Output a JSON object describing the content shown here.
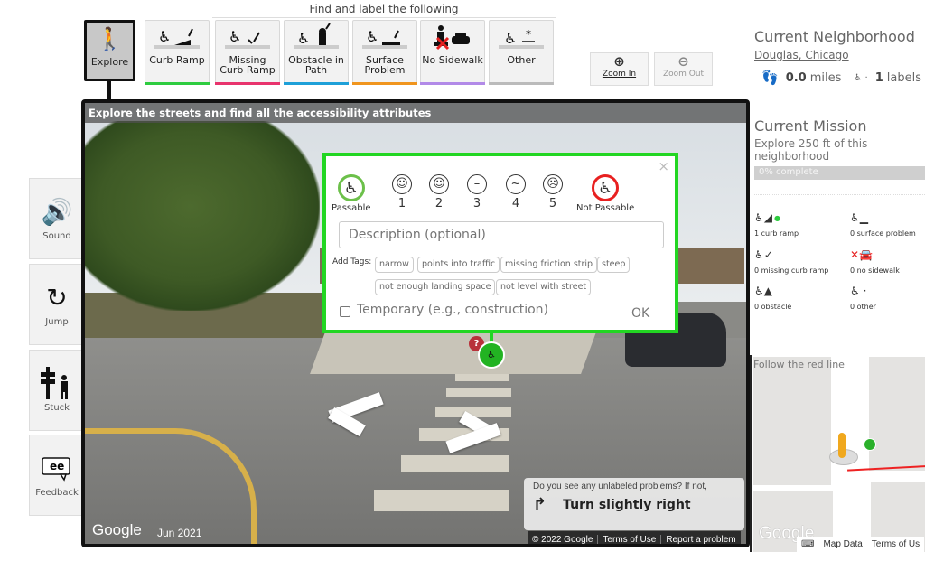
{
  "toolbar": {
    "find_title": "Find and label the following",
    "explore": {
      "label": "Explore",
      "icon": "walking-person-icon"
    },
    "tools": [
      {
        "label": "Curb Ramp",
        "icon": "curb-ramp-icon",
        "color": "#2ecc40"
      },
      {
        "label": "Missing Curb Ramp",
        "icon": "missing-curb-ramp-icon",
        "color": "#e8336d"
      },
      {
        "label": "Obstacle in Path",
        "icon": "obstacle-icon",
        "color": "#1ea0d8"
      },
      {
        "label": "Surface Problem",
        "icon": "surface-problem-icon",
        "color": "#f0951e"
      },
      {
        "label": "No Sidewalk",
        "icon": "no-sidewalk-icon",
        "color": "#b28ae8"
      },
      {
        "label": "Other",
        "icon": "other-icon",
        "color": "#bbbbbb"
      }
    ],
    "zoom_in": "Zoom In",
    "zoom_out": "Zoom Out"
  },
  "side_buttons": [
    {
      "label": "Sound",
      "icon": "speaker-icon"
    },
    {
      "label": "Jump",
      "icon": "jump-icon"
    },
    {
      "label": "Stuck",
      "icon": "stuck-icon"
    },
    {
      "label": "Feedback",
      "icon": "feedback-icon"
    }
  ],
  "streetview": {
    "title": "Explore the streets and find all the accessibility attributes",
    "google": "Google",
    "date": "Jun 2021",
    "footer": [
      "© 2022 Google",
      "Terms of Use",
      "Report a problem"
    ],
    "hint_question": "Do you see any unlabeled problems? If not,",
    "hint_action": "Turn slightly right"
  },
  "popup": {
    "close": "×",
    "passable": "Passable",
    "not_passable": "Not Passable",
    "severity": [
      "1",
      "2",
      "3",
      "4",
      "5"
    ],
    "description_placeholder": "Description (optional)",
    "tags_label": "Add Tags:",
    "tags": [
      "narrow",
      "points into traffic",
      "missing friction strip",
      "steep",
      "not enough landing space",
      "not level with street"
    ],
    "temporary_label": "Temporary (e.g., construction)",
    "ok": "OK",
    "question_marker": "?"
  },
  "neighborhood": {
    "title": "Current Neighborhood",
    "name": "Douglas, Chicago",
    "miles": "0.0",
    "miles_unit": "miles",
    "labels": "1",
    "labels_unit": "labels"
  },
  "mission": {
    "title": "Current Mission",
    "description": "Explore 250 ft of this neighborhood",
    "progress_percent": 0,
    "progress_text": "0% complete",
    "counts": [
      {
        "text": "1 curb ramp",
        "icon": "curb-ramp-icon"
      },
      {
        "text": "0 surface problem",
        "icon": "surface-problem-icon"
      },
      {
        "text": "0 missing curb ramp",
        "icon": "missing-curb-ramp-icon"
      },
      {
        "text": "0 no sidewalk",
        "icon": "no-sidewalk-icon"
      },
      {
        "text": "0 obstacle",
        "icon": "obstacle-icon"
      },
      {
        "text": "0 other",
        "icon": "other-icon"
      }
    ]
  },
  "minimap": {
    "instruction": "Follow the red line",
    "google": "Google",
    "footer": [
      "Map Data",
      "Terms of Us"
    ]
  }
}
